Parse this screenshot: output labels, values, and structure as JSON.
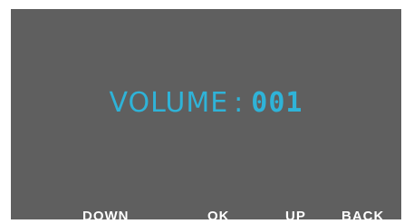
{
  "display": {
    "volume_label": "VOLUME",
    "separator": ":",
    "volume_value": "001",
    "text_color": "#2fb3d8",
    "background_color": "#5f5f5f"
  },
  "softkeys": {
    "down_label": "DOWN",
    "ok_label": "OK",
    "up_label": "UP",
    "back_label": "BACK"
  }
}
